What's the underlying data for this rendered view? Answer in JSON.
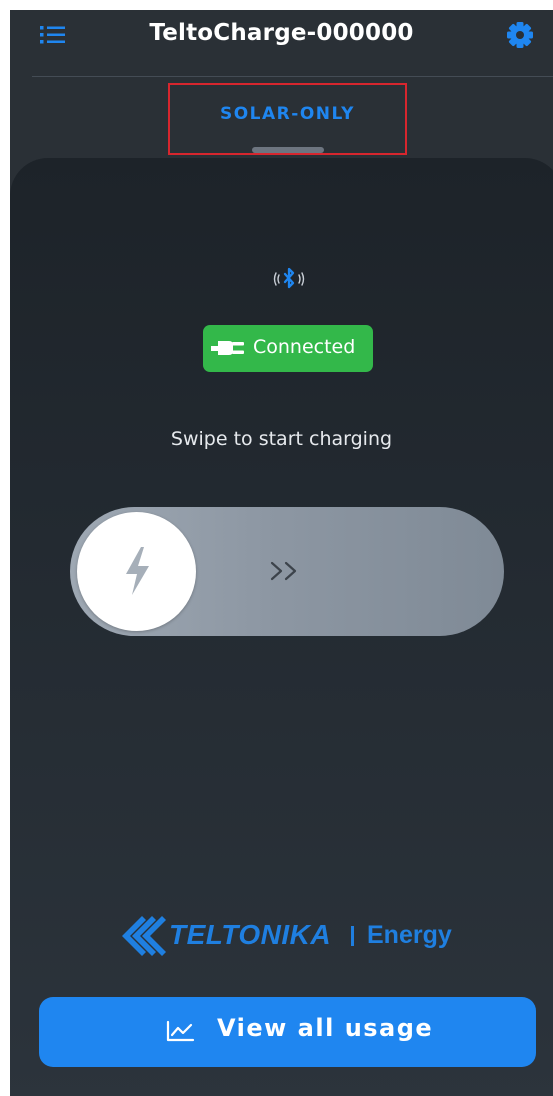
{
  "header": {
    "title": "TeltoCharge-000000",
    "menu_icon": "list-icon",
    "settings_icon": "gear-icon"
  },
  "mode": {
    "label": "SOLAR-ONLY"
  },
  "status": {
    "bluetooth_icon": "bluetooth-signal-icon",
    "connection_label": "Connected",
    "connection_icon": "plug-icon",
    "connection_color": "#33b84a"
  },
  "swipe": {
    "hint": "Swipe to start charging",
    "knob_icon": "lightning-bolt-icon",
    "arrow_icon": "double-chevron-right-icon"
  },
  "brand": {
    "name": "TELTONIKA",
    "product": "Energy",
    "color": "#1f7fe0"
  },
  "footer": {
    "button_label": "View all usage",
    "button_icon": "line-chart-icon",
    "accent_color": "#1f86f0"
  }
}
